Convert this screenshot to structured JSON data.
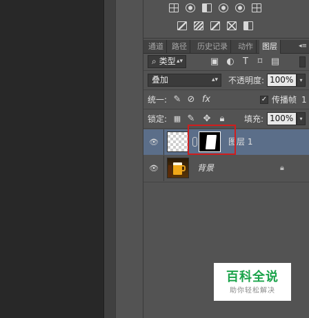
{
  "tabs": [
    {
      "label": "通道"
    },
    {
      "label": "路径"
    },
    {
      "label": "历史记录"
    },
    {
      "label": "动作"
    },
    {
      "label": "图层"
    }
  ],
  "active_tab": "图层",
  "filter": {
    "kind_label": "类型",
    "search_glyph": "⌕"
  },
  "blend": {
    "mode": "叠加",
    "opacity_label": "不透明度:",
    "opacity_value": "100%"
  },
  "unify": {
    "label": "统一:",
    "propagate_label": "传播帧",
    "propagate_value": "1",
    "propagate_checked": true
  },
  "lock": {
    "label": "锁定:",
    "fill_label": "填充:",
    "fill_value": "100%"
  },
  "layers": [
    {
      "name": "图层 1",
      "selected": true,
      "has_mask": true
    },
    {
      "name": "背景",
      "selected": false,
      "locked": true
    }
  ],
  "watermark": {
    "title": "百科全说",
    "subtitle": "助你轻松解决"
  },
  "colors": {
    "selection": "#5b6e89",
    "highlight": "#d21c1c",
    "watermark_green": "#1aa34a"
  }
}
